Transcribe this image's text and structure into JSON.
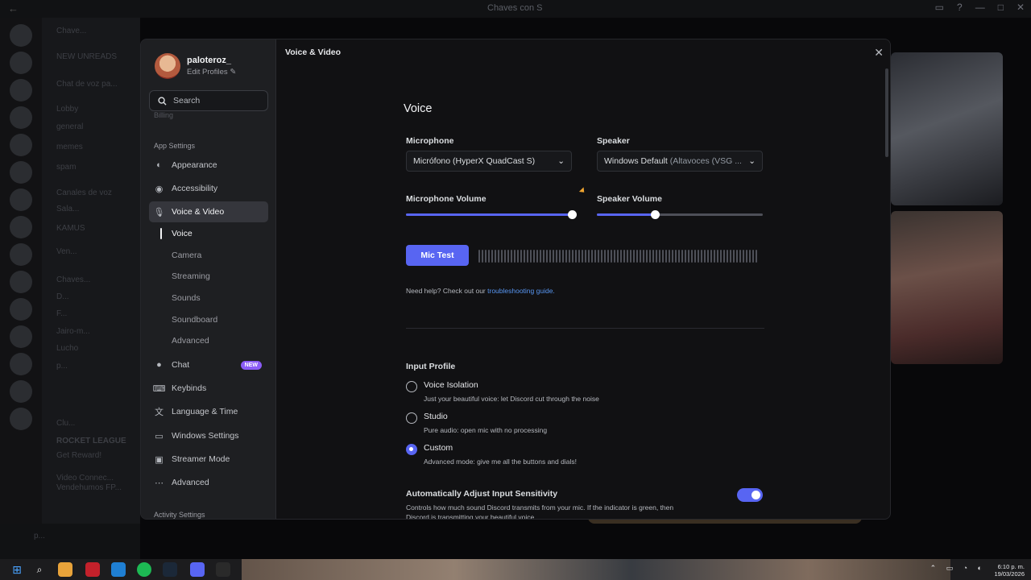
{
  "window": {
    "title": "Chaves con S"
  },
  "background": {
    "channels": [
      "Chave...",
      "NEW UNREADS",
      "Chat de voz pa...",
      "Lobby",
      "general",
      "memes",
      "spam",
      "Canales de voz",
      "Sala...",
      "KAMUS",
      "Ven...",
      "Chaves...",
      "D...",
      "F...",
      "Jairo-m...",
      "Lucho",
      "p...",
      "Clu...",
      "ROCKET LEAGUE",
      "Get Reward!",
      "Video Connec...",
      "Vendehumos FP...",
      "p..."
    ]
  },
  "profile": {
    "username": "paloteroz_",
    "edit_label": "Edit Profiles"
  },
  "search": {
    "placeholder": "Search"
  },
  "sidebar": {
    "partial_item": "Billing",
    "app_settings_label": "App Settings",
    "items": [
      {
        "label": "Appearance",
        "icon": "palette-icon"
      },
      {
        "label": "Accessibility",
        "icon": "accessibility-icon"
      },
      {
        "label": "Voice & Video",
        "icon": "microphone-icon"
      },
      {
        "label": "Chat",
        "icon": "chat-icon",
        "badge": "NEW"
      },
      {
        "label": "Keybinds",
        "icon": "keyboard-icon"
      },
      {
        "label": "Language & Time",
        "icon": "language-icon"
      },
      {
        "label": "Windows Settings",
        "icon": "monitor-icon"
      },
      {
        "label": "Streamer Mode",
        "icon": "stream-icon"
      },
      {
        "label": "Advanced",
        "icon": "more-icon"
      }
    ],
    "sub_items": [
      "Voice",
      "Camera",
      "Streaming",
      "Sounds",
      "Soundboard",
      "Advanced"
    ],
    "activity_settings_label": "Activity Settings"
  },
  "content": {
    "header": "Voice & Video",
    "section_title": "Voice",
    "microphone": {
      "label": "Microphone",
      "value": "Micrófono (HyperX QuadCast S)"
    },
    "speaker": {
      "label": "Speaker",
      "value": "Windows Default",
      "value_dim": "(Altavoces (VSG ..."
    },
    "mic_volume": {
      "label": "Microphone Volume",
      "level": 1.0
    },
    "speaker_volume": {
      "label": "Speaker Volume",
      "level": 0.35
    },
    "mic_test_label": "Mic Test",
    "help_text": "Need help? Check out our",
    "help_link": "troubleshooting guide.",
    "input_profile": {
      "title": "Input Profile",
      "options": [
        {
          "title": "Voice Isolation",
          "desc": "Just your beautiful voice: let Discord cut through the noise",
          "checked": false
        },
        {
          "title": "Studio",
          "desc": "Pure audio: open mic with no processing",
          "checked": false
        },
        {
          "title": "Custom",
          "desc": "Advanced mode: give me all the buttons and dials!",
          "checked": true
        }
      ]
    },
    "auto_sensitivity": {
      "title": "Automatically Adjust Input Sensitivity",
      "desc": "Controls how much sound Discord transmits from your mic. If the indicator is green, then Discord is transmitting your beautiful voice.",
      "enabled": true
    }
  },
  "taskbar": {
    "time": "6:10 p. m.",
    "date": "19/03/2026"
  },
  "colors": {
    "accent": "#5865f2",
    "link": "#5896f2",
    "badge": "#8b5cf6"
  }
}
